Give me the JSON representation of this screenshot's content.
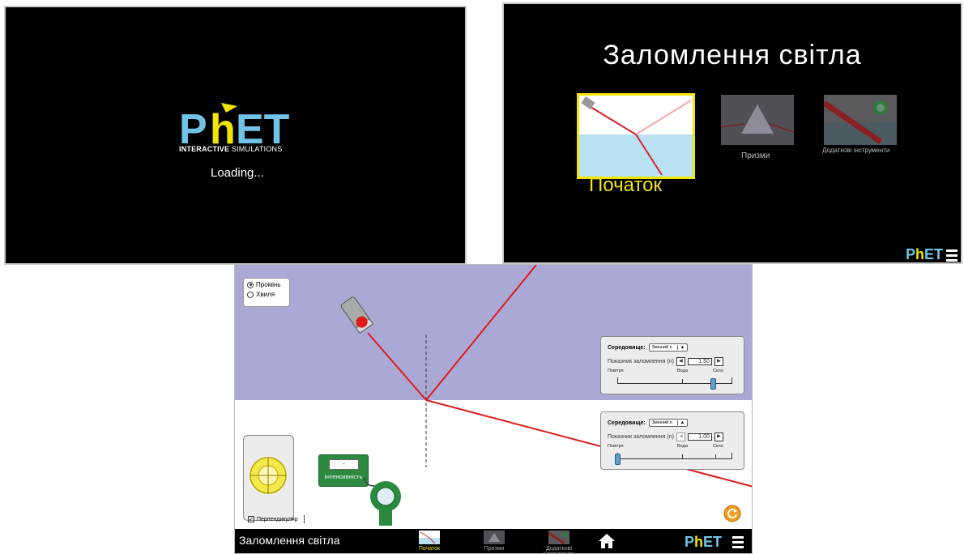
{
  "loading_screen": {
    "logo_text": "PhET",
    "logo_sub_bold": "INTERACTIVE",
    "logo_sub": "SIMULATIONS",
    "status": "Loading..."
  },
  "home_screen": {
    "title": "Заломлення світла",
    "screens": [
      {
        "label": "Початок",
        "selected": true
      },
      {
        "label": "Призми",
        "selected": false
      },
      {
        "label": "Додаткові інструменти",
        "selected": false
      }
    ],
    "footer_logo": "PhET"
  },
  "sim_screen": {
    "view_options": [
      {
        "label": "Промінь",
        "selected": true
      },
      {
        "label": "Хвиля",
        "selected": false
      }
    ],
    "top_medium": {
      "medium_label": "Середовище:",
      "medium_value": "Змінний n",
      "index_label": "Показник заломлення (n)",
      "index_value": "1.50",
      "slider_labels": [
        "Повітря",
        "Вода",
        "Скло"
      ],
      "slider_level": 0.84
    },
    "bottom_medium": {
      "medium_label": "Середовище:",
      "medium_value": "Змінний n",
      "index_label": "Показник заломлення (n)",
      "index_value": "1.00",
      "slider_labels": [
        "Повітря",
        "Вода",
        "Скло"
      ],
      "slider_level": 0.0
    },
    "intensity_meter": {
      "value": "-",
      "label": "Інтенсивність"
    },
    "perpendicular": {
      "label": "Перпендикуляр",
      "checked": true
    },
    "navbar": {
      "title": "Заломлення світла",
      "tabs": [
        "Початок",
        "Призми",
        "Додаткові інструменти"
      ],
      "logo": "PhET"
    },
    "colors": {
      "top_medium": "#aaa9d6",
      "beam": "#e01919",
      "selected_tab": "#f2e600",
      "meter": "#2b8a3e"
    }
  }
}
